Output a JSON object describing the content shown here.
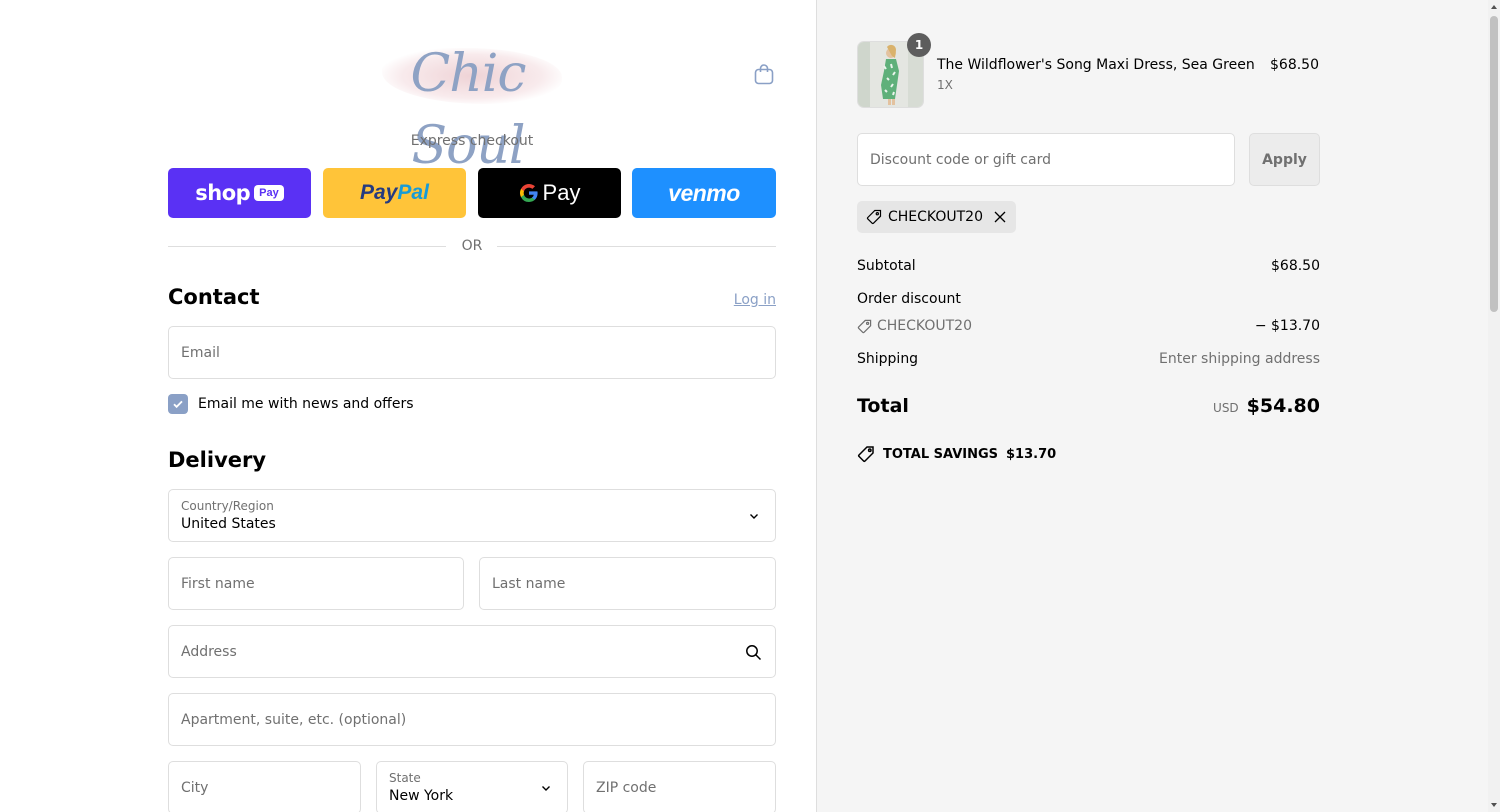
{
  "brand": {
    "logo_text": "Chic Soul"
  },
  "express": {
    "label": "Express checkout",
    "shop_pay": {
      "word": "shop",
      "badge": "Pay"
    },
    "paypal": {
      "part1": "Pay",
      "part2": "Pal"
    },
    "gpay": {
      "word": "Pay"
    },
    "venmo": {
      "word": "venmo"
    }
  },
  "divider": {
    "or": "OR"
  },
  "contact": {
    "title": "Contact",
    "login_link": "Log in",
    "email_placeholder": "Email",
    "newsletter_label": "Email me with news and offers",
    "newsletter_checked": true
  },
  "delivery": {
    "title": "Delivery",
    "country_label": "Country/Region",
    "country_value": "United States",
    "first_name_placeholder": "First name",
    "last_name_placeholder": "Last name",
    "address_placeholder": "Address",
    "apartment_placeholder": "Apartment, suite, etc. (optional)",
    "city_placeholder": "City",
    "state_label": "State",
    "state_value": "New York",
    "zip_placeholder": "ZIP code"
  },
  "summary": {
    "item": {
      "quantity_badge": "1",
      "name": "The Wildflower's Song Maxi Dress, Sea Green",
      "variant": "1X",
      "price": "$68.50"
    },
    "discount_placeholder": "Discount code or gift card",
    "apply_label": "Apply",
    "applied_code": "CHECKOUT20",
    "subtotal_label": "Subtotal",
    "subtotal_value": "$68.50",
    "order_discount_label": "Order discount",
    "order_discount_code": "CHECKOUT20",
    "order_discount_value": "− $13.70",
    "shipping_label": "Shipping",
    "shipping_value": "Enter shipping address",
    "total_label": "Total",
    "currency": "USD",
    "total_value": "$54.80",
    "savings_label": "TOTAL SAVINGS",
    "savings_value": "$13.70"
  },
  "colors": {
    "accent": "#8aa0c6",
    "shop_pay": "#5a31f4",
    "paypal": "#ffc439",
    "gpay": "#000000",
    "venmo": "#1e90ff",
    "summary_bg": "#f5f5f5"
  }
}
